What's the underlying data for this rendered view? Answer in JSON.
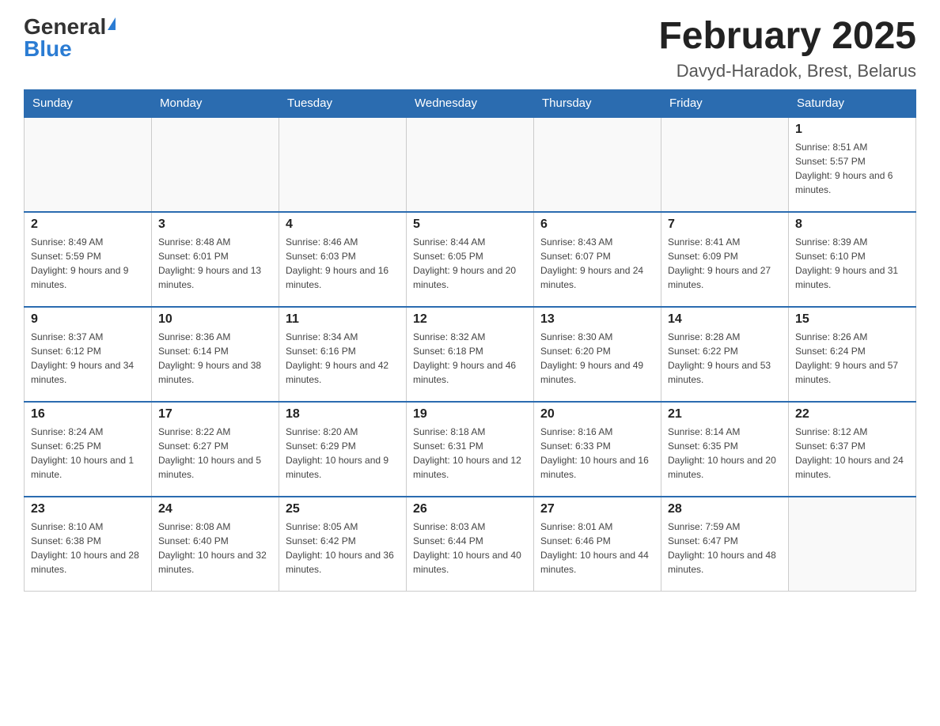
{
  "header": {
    "logo_general": "General",
    "logo_blue": "Blue",
    "title": "February 2025",
    "subtitle": "Davyd-Haradok, Brest, Belarus"
  },
  "weekdays": [
    "Sunday",
    "Monday",
    "Tuesday",
    "Wednesday",
    "Thursday",
    "Friday",
    "Saturday"
  ],
  "weeks": [
    [
      {
        "day": "",
        "info": ""
      },
      {
        "day": "",
        "info": ""
      },
      {
        "day": "",
        "info": ""
      },
      {
        "day": "",
        "info": ""
      },
      {
        "day": "",
        "info": ""
      },
      {
        "day": "",
        "info": ""
      },
      {
        "day": "1",
        "info": "Sunrise: 8:51 AM\nSunset: 5:57 PM\nDaylight: 9 hours and 6 minutes."
      }
    ],
    [
      {
        "day": "2",
        "info": "Sunrise: 8:49 AM\nSunset: 5:59 PM\nDaylight: 9 hours and 9 minutes."
      },
      {
        "day": "3",
        "info": "Sunrise: 8:48 AM\nSunset: 6:01 PM\nDaylight: 9 hours and 13 minutes."
      },
      {
        "day": "4",
        "info": "Sunrise: 8:46 AM\nSunset: 6:03 PM\nDaylight: 9 hours and 16 minutes."
      },
      {
        "day": "5",
        "info": "Sunrise: 8:44 AM\nSunset: 6:05 PM\nDaylight: 9 hours and 20 minutes."
      },
      {
        "day": "6",
        "info": "Sunrise: 8:43 AM\nSunset: 6:07 PM\nDaylight: 9 hours and 24 minutes."
      },
      {
        "day": "7",
        "info": "Sunrise: 8:41 AM\nSunset: 6:09 PM\nDaylight: 9 hours and 27 minutes."
      },
      {
        "day": "8",
        "info": "Sunrise: 8:39 AM\nSunset: 6:10 PM\nDaylight: 9 hours and 31 minutes."
      }
    ],
    [
      {
        "day": "9",
        "info": "Sunrise: 8:37 AM\nSunset: 6:12 PM\nDaylight: 9 hours and 34 minutes."
      },
      {
        "day": "10",
        "info": "Sunrise: 8:36 AM\nSunset: 6:14 PM\nDaylight: 9 hours and 38 minutes."
      },
      {
        "day": "11",
        "info": "Sunrise: 8:34 AM\nSunset: 6:16 PM\nDaylight: 9 hours and 42 minutes."
      },
      {
        "day": "12",
        "info": "Sunrise: 8:32 AM\nSunset: 6:18 PM\nDaylight: 9 hours and 46 minutes."
      },
      {
        "day": "13",
        "info": "Sunrise: 8:30 AM\nSunset: 6:20 PM\nDaylight: 9 hours and 49 minutes."
      },
      {
        "day": "14",
        "info": "Sunrise: 8:28 AM\nSunset: 6:22 PM\nDaylight: 9 hours and 53 minutes."
      },
      {
        "day": "15",
        "info": "Sunrise: 8:26 AM\nSunset: 6:24 PM\nDaylight: 9 hours and 57 minutes."
      }
    ],
    [
      {
        "day": "16",
        "info": "Sunrise: 8:24 AM\nSunset: 6:25 PM\nDaylight: 10 hours and 1 minute."
      },
      {
        "day": "17",
        "info": "Sunrise: 8:22 AM\nSunset: 6:27 PM\nDaylight: 10 hours and 5 minutes."
      },
      {
        "day": "18",
        "info": "Sunrise: 8:20 AM\nSunset: 6:29 PM\nDaylight: 10 hours and 9 minutes."
      },
      {
        "day": "19",
        "info": "Sunrise: 8:18 AM\nSunset: 6:31 PM\nDaylight: 10 hours and 12 minutes."
      },
      {
        "day": "20",
        "info": "Sunrise: 8:16 AM\nSunset: 6:33 PM\nDaylight: 10 hours and 16 minutes."
      },
      {
        "day": "21",
        "info": "Sunrise: 8:14 AM\nSunset: 6:35 PM\nDaylight: 10 hours and 20 minutes."
      },
      {
        "day": "22",
        "info": "Sunrise: 8:12 AM\nSunset: 6:37 PM\nDaylight: 10 hours and 24 minutes."
      }
    ],
    [
      {
        "day": "23",
        "info": "Sunrise: 8:10 AM\nSunset: 6:38 PM\nDaylight: 10 hours and 28 minutes."
      },
      {
        "day": "24",
        "info": "Sunrise: 8:08 AM\nSunset: 6:40 PM\nDaylight: 10 hours and 32 minutes."
      },
      {
        "day": "25",
        "info": "Sunrise: 8:05 AM\nSunset: 6:42 PM\nDaylight: 10 hours and 36 minutes."
      },
      {
        "day": "26",
        "info": "Sunrise: 8:03 AM\nSunset: 6:44 PM\nDaylight: 10 hours and 40 minutes."
      },
      {
        "day": "27",
        "info": "Sunrise: 8:01 AM\nSunset: 6:46 PM\nDaylight: 10 hours and 44 minutes."
      },
      {
        "day": "28",
        "info": "Sunrise: 7:59 AM\nSunset: 6:47 PM\nDaylight: 10 hours and 48 minutes."
      },
      {
        "day": "",
        "info": ""
      }
    ]
  ]
}
